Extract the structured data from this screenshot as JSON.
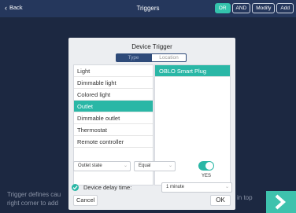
{
  "header": {
    "back_label": "Back",
    "title": "Triggers",
    "buttons": [
      "OR",
      "AND",
      "Modify",
      "Add"
    ]
  },
  "background": {
    "hint_text": "Trigger defines cau",
    "hint_text_line2": "right corner to add",
    "hint_right": "in top"
  },
  "dialog": {
    "title": "Device Trigger",
    "tabs": [
      "Type",
      "Location"
    ],
    "left_items": [
      "Light",
      "Dimmable light",
      "Colored light",
      "Outlet",
      "Dimmable outlet",
      "Thermostat",
      "Remote controller"
    ],
    "left_selected_index": 3,
    "right_items": [
      "OBLO Smart Plug"
    ],
    "state_select": "Outlet state",
    "operator_select": "Equal",
    "toggle_on": true,
    "toggle_label": "YES",
    "delay_label": "Device delay time:",
    "delay_value": "1 minute",
    "cancel_label": "Cancel",
    "ok_label": "OK"
  },
  "colors": {
    "accent": "#2ab7a6",
    "header_bg": "#25375c",
    "page_bg": "#1c2841",
    "tab_active": "#2e4a79"
  }
}
